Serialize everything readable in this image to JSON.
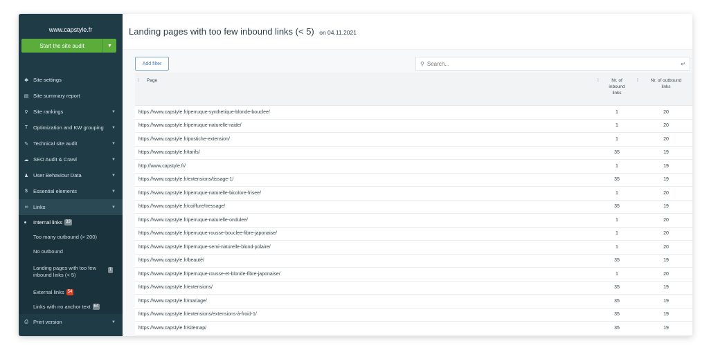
{
  "sidebar": {
    "site": "www.capstyle.fr",
    "audit_button": "Start the site audit",
    "items": [
      {
        "label": "Site settings",
        "icon": "gear-icon",
        "glyph": "✱",
        "chevron": false
      },
      {
        "label": "Site summary report",
        "icon": "report-icon",
        "glyph": "▤",
        "chevron": false
      },
      {
        "label": "Site rankings",
        "icon": "search-icon",
        "glyph": "⚲",
        "chevron": true
      },
      {
        "label": "Optimization and KW grouping",
        "icon": "text-icon",
        "glyph": "T",
        "chevron": true
      },
      {
        "label": "Technical site audit",
        "icon": "wrench-icon",
        "glyph": "✎",
        "chevron": true
      },
      {
        "label": "SEO Audit & Crawl",
        "icon": "cloud-icon",
        "glyph": "☁",
        "chevron": true
      },
      {
        "label": "User Behaviour Data",
        "icon": "user-icon",
        "glyph": "♟",
        "chevron": true
      },
      {
        "label": "Essential elements",
        "icon": "dollar-icon",
        "glyph": "$",
        "chevron": true
      }
    ],
    "links": {
      "label": "Links",
      "icon": "link-icon",
      "sub": [
        {
          "label": "Internal links",
          "badge": "33"
        },
        {
          "label": "Too many outbound (> 200)",
          "badge": ""
        },
        {
          "label": "No outbound",
          "badge": ""
        },
        {
          "label": "Landing pages with too few inbound links (< 5)",
          "badge": "1"
        },
        {
          "label": "External links",
          "badge": "54"
        },
        {
          "label": "Links with no anchor text",
          "badge": "64"
        }
      ]
    },
    "print_version": {
      "label": "Print version",
      "icon": "print-icon"
    }
  },
  "header": {
    "title": "Landing pages with too few inbound links (< 5)",
    "date": "on 04.11.2021"
  },
  "toolbar": {
    "add_filter": "Add filter",
    "search_placeholder": "Search..."
  },
  "table": {
    "columns": {
      "page": "Page",
      "inbound": "Nr. of inbound links",
      "outbound": "Nr. of outbound links"
    },
    "rows": [
      {
        "url": "https://www.capstyle.fr/perruque-synthetique-blonde-bouclee/",
        "inbound": "1",
        "outbound": "20"
      },
      {
        "url": "https://www.capstyle.fr/perruque-naturelle-raide/",
        "inbound": "1",
        "outbound": "20"
      },
      {
        "url": "https://www.capstyle.fr/postiche-extension/",
        "inbound": "1",
        "outbound": "20"
      },
      {
        "url": "https://www.capstyle.fr/tarifs/",
        "inbound": "35",
        "outbound": "19"
      },
      {
        "url": "http://www.capstyle.fr/",
        "inbound": "1",
        "outbound": "19"
      },
      {
        "url": "https://www.capstyle.fr/extensions/tissage-1/",
        "inbound": "35",
        "outbound": "19"
      },
      {
        "url": "https://www.capstyle.fr/perruque-naturelle-bicolore-frisee/",
        "inbound": "1",
        "outbound": "20"
      },
      {
        "url": "https://www.capstyle.fr/coiffure/tressage/",
        "inbound": "35",
        "outbound": "19"
      },
      {
        "url": "https://www.capstyle.fr/perruque-naturelle-ondulee/",
        "inbound": "1",
        "outbound": "20"
      },
      {
        "url": "https://www.capstyle.fr/perruque-rousse-bouclee-fibre-japonaise/",
        "inbound": "1",
        "outbound": "20"
      },
      {
        "url": "https://www.capstyle.fr/perruque-semi-naturelle-blond-polaire/",
        "inbound": "1",
        "outbound": "20"
      },
      {
        "url": "https://www.capstyle.fr/beauté/",
        "inbound": "35",
        "outbound": "19"
      },
      {
        "url": "https://www.capstyle.fr/perruque-rousse-et-blonde-fibre-japonaise/",
        "inbound": "1",
        "outbound": "20"
      },
      {
        "url": "https://www.capstyle.fr/extensions/",
        "inbound": "35",
        "outbound": "19"
      },
      {
        "url": "https://www.capstyle.fr/mariage/",
        "inbound": "35",
        "outbound": "19"
      },
      {
        "url": "https://www.capstyle.fr/extensions/extensions-à-froid-1/",
        "inbound": "35",
        "outbound": "19"
      },
      {
        "url": "https://www.capstyle.fr/sitemap/",
        "inbound": "35",
        "outbound": "19"
      }
    ]
  },
  "colors": {
    "sidebar": "#1f3b46",
    "accent_green": "#5aad3b",
    "badge_red": "#d5452b"
  }
}
